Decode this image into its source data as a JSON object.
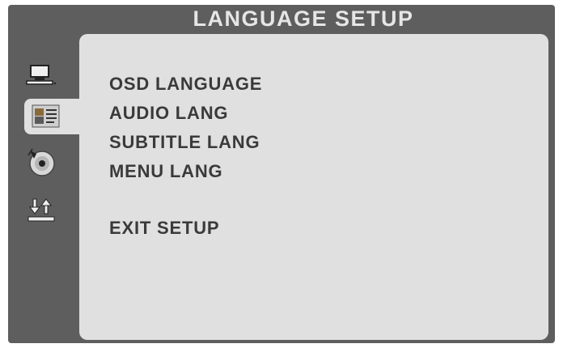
{
  "header": {
    "title": "LANGUAGE SETUP"
  },
  "tabs": [
    {
      "icon": "monitor-icon",
      "active": false
    },
    {
      "icon": "language-icon",
      "active": true
    },
    {
      "icon": "disc-icon",
      "active": false
    },
    {
      "icon": "arrows-icon",
      "active": false
    }
  ],
  "menu": {
    "items": [
      {
        "label": "OSD LANGUAGE"
      },
      {
        "label": "AUDIO LANG"
      },
      {
        "label": "SUBTITLE LANG"
      },
      {
        "label": "MENU LANG"
      }
    ],
    "exit_label": "EXIT SETUP"
  },
  "colors": {
    "frame": "#5e5e5e",
    "panel": "#e0e0e0",
    "title_text": "#e6e6e6",
    "menu_text": "#3a3a3a"
  }
}
